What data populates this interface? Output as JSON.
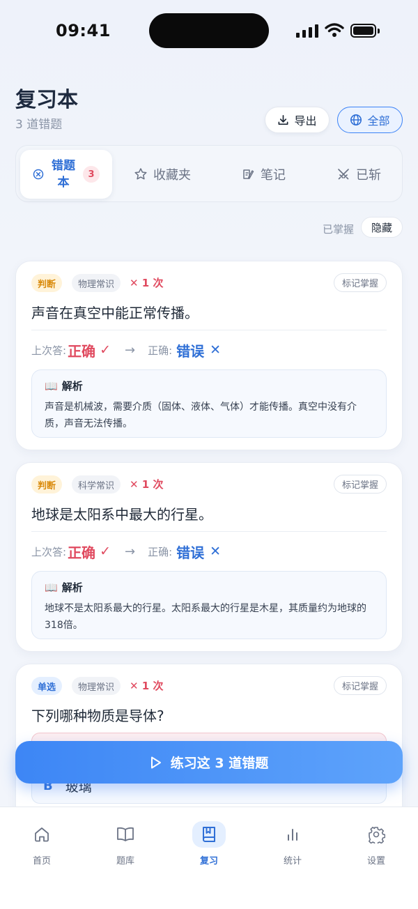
{
  "status": {
    "time": "09:41"
  },
  "header": {
    "title": "复习本",
    "subtitle": "3 道错题",
    "export_label": "导出",
    "filter_label": "全部"
  },
  "tabs": [
    {
      "label": "错题本",
      "badge": "3",
      "icon": "x-circle-icon",
      "active": true
    },
    {
      "label": "收藏夹",
      "icon": "star-icon"
    },
    {
      "label": "笔记",
      "icon": "note-icon"
    },
    {
      "label": "已斩",
      "icon": "swords-icon"
    }
  ],
  "mastered": {
    "label": "已掌握",
    "toggle_label": "隐藏"
  },
  "cards": [
    {
      "type": "判断",
      "subject": "物理常识",
      "wrong_count": "✕ 1 次",
      "mark_label": "标记掌握",
      "question": "声音在真空中能正常传播。",
      "last_label": "上次答:",
      "last_answer": "正确",
      "correct_label": "正确:",
      "correct_answer": "错误",
      "explain_title": "解析",
      "explain_text": "声音是机械波，需要介质（固体、液体、气体）才能传播。真空中没有介质，声音无法传播。"
    },
    {
      "type": "判断",
      "subject": "科学常识",
      "wrong_count": "✕ 1 次",
      "mark_label": "标记掌握",
      "question": "地球是太阳系中最大的行星。",
      "last_label": "上次答:",
      "last_answer": "正确",
      "correct_label": "正确:",
      "correct_answer": "错误",
      "explain_title": "解析",
      "explain_text": "地球不是太阳系最大的行星。太阳系最大的行星是木星，其质量约为地球的318倍。"
    },
    {
      "type": "单选",
      "subject": "物理常识",
      "wrong_count": "✕ 1 次",
      "mark_label": "标记掌握",
      "question": "下列哪种物质是导体?",
      "option_b_letter": "B",
      "option_b_text": "玻璃"
    }
  ],
  "practice_label": "练习这 3 道错题",
  "nav": [
    {
      "label": "首页",
      "icon": "home-icon"
    },
    {
      "label": "题库",
      "icon": "book-open-icon"
    },
    {
      "label": "复习",
      "icon": "bookmark-book-icon",
      "active": true
    },
    {
      "label": "统计",
      "icon": "bar-chart-icon"
    },
    {
      "label": "设置",
      "icon": "gear-icon"
    }
  ],
  "colors": {
    "accent": "#3b82f6",
    "error": "#e04a5f",
    "warning": "#d98a0b"
  }
}
